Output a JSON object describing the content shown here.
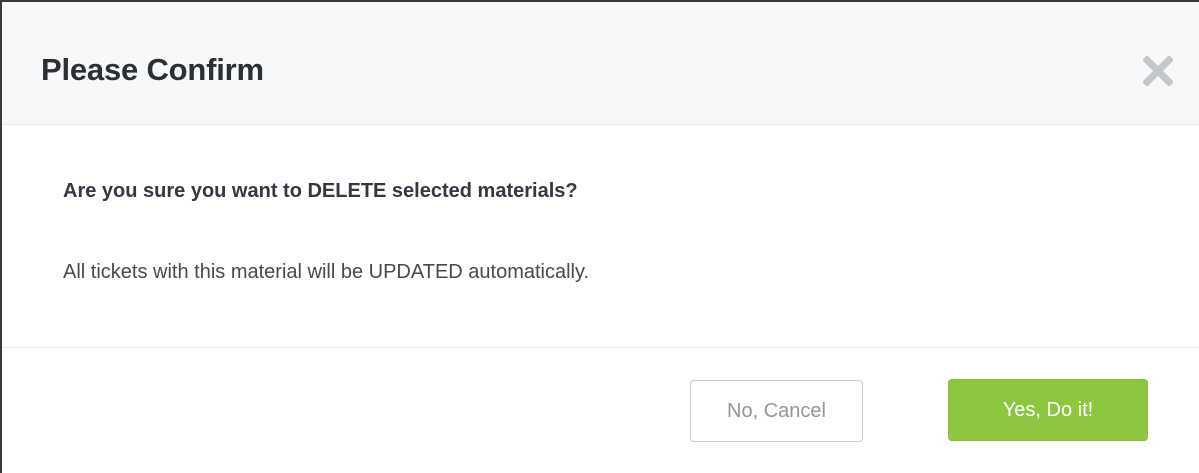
{
  "dialog": {
    "title": "Please Confirm",
    "close_icon": "close-icon",
    "question": "Are you sure you want to DELETE selected materials?",
    "note": "All tickets with this material will be UPDATED automatically.",
    "cancel_label": "No, Cancel",
    "confirm_label": "Yes, Do it!"
  },
  "colors": {
    "header_bg": "#f7f8f9",
    "title_text": "#2b2f36",
    "confirm_bg": "#8dc63f",
    "cancel_border": "#c7cdd4",
    "cancel_text": "#8f969e",
    "close_icon": "#c3c6ca"
  }
}
